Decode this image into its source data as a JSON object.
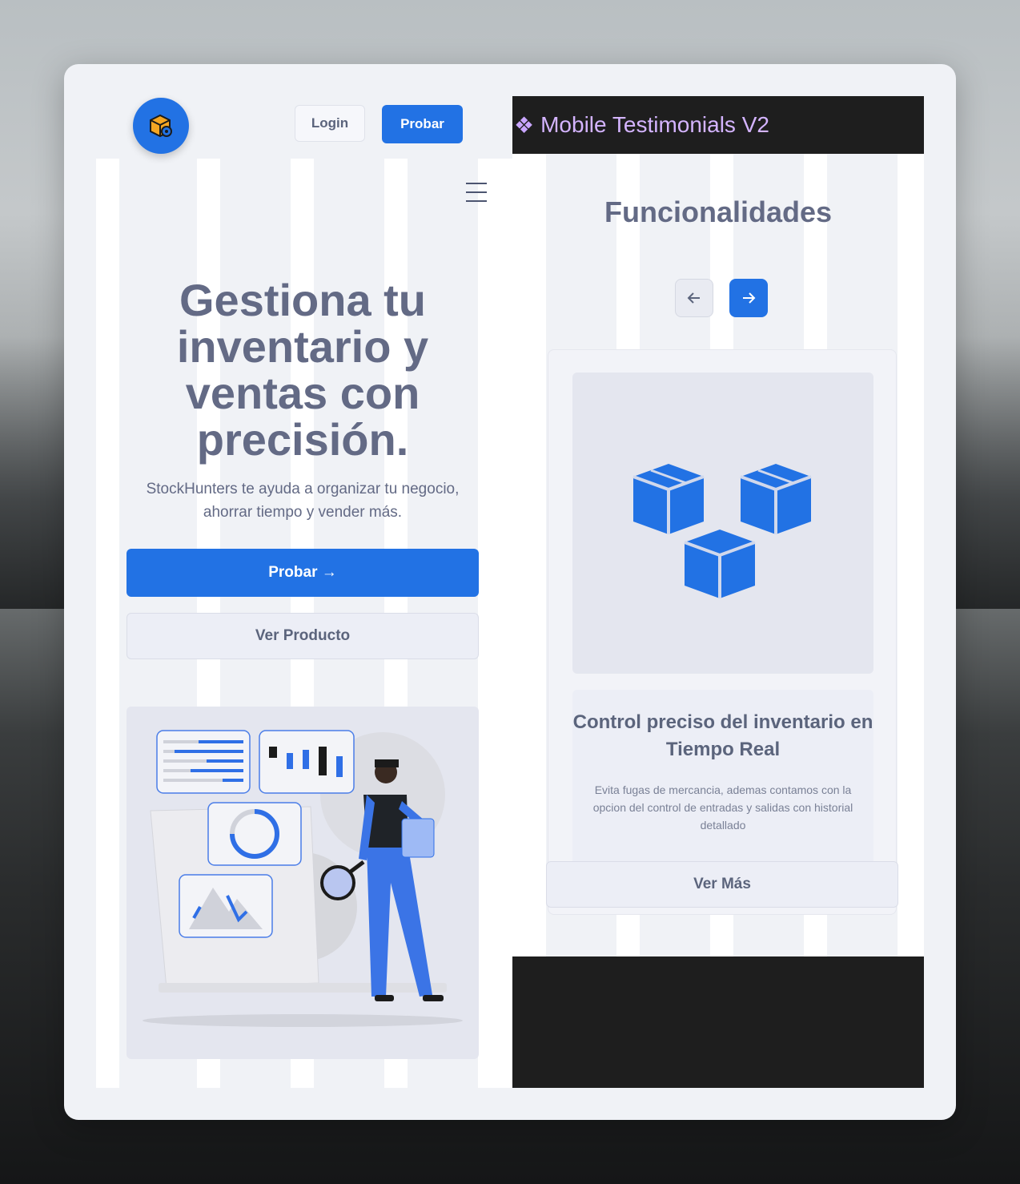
{
  "left": {
    "logo_icon": "box-gear-icon",
    "login_label": "Login",
    "probar_top_label": "Probar",
    "menu_icon": "hamburger-menu-icon",
    "hero_title": "Gestiona tu inventario y ventas con precisión.",
    "hero_subtitle": "StockHunters te ayuda a organizar tu negocio, ahorrar tiempo y vender más.",
    "probar_main_label": "Probar →",
    "ver_producto_label": "Ver Producto"
  },
  "right": {
    "header_icon": "component-diamond-icon",
    "header_title": "Mobile Testimonials V2",
    "section_title": "Funcionalidades",
    "prev_icon": "arrow-left-icon",
    "next_icon": "arrow-right-icon",
    "feature": {
      "title": "Control preciso del inventario en Tiempo Real",
      "description": "Evita fugas de mercancia, ademas contamos con la opcion del control de entradas y salidas con historial detallado",
      "button_label": "Ver Más",
      "image_icon": "boxes-icon"
    }
  },
  "colors": {
    "accent": "#2272e4",
    "text": "#636a85",
    "header_text": "#d4b4ff",
    "dark": "#1e1e1e"
  }
}
